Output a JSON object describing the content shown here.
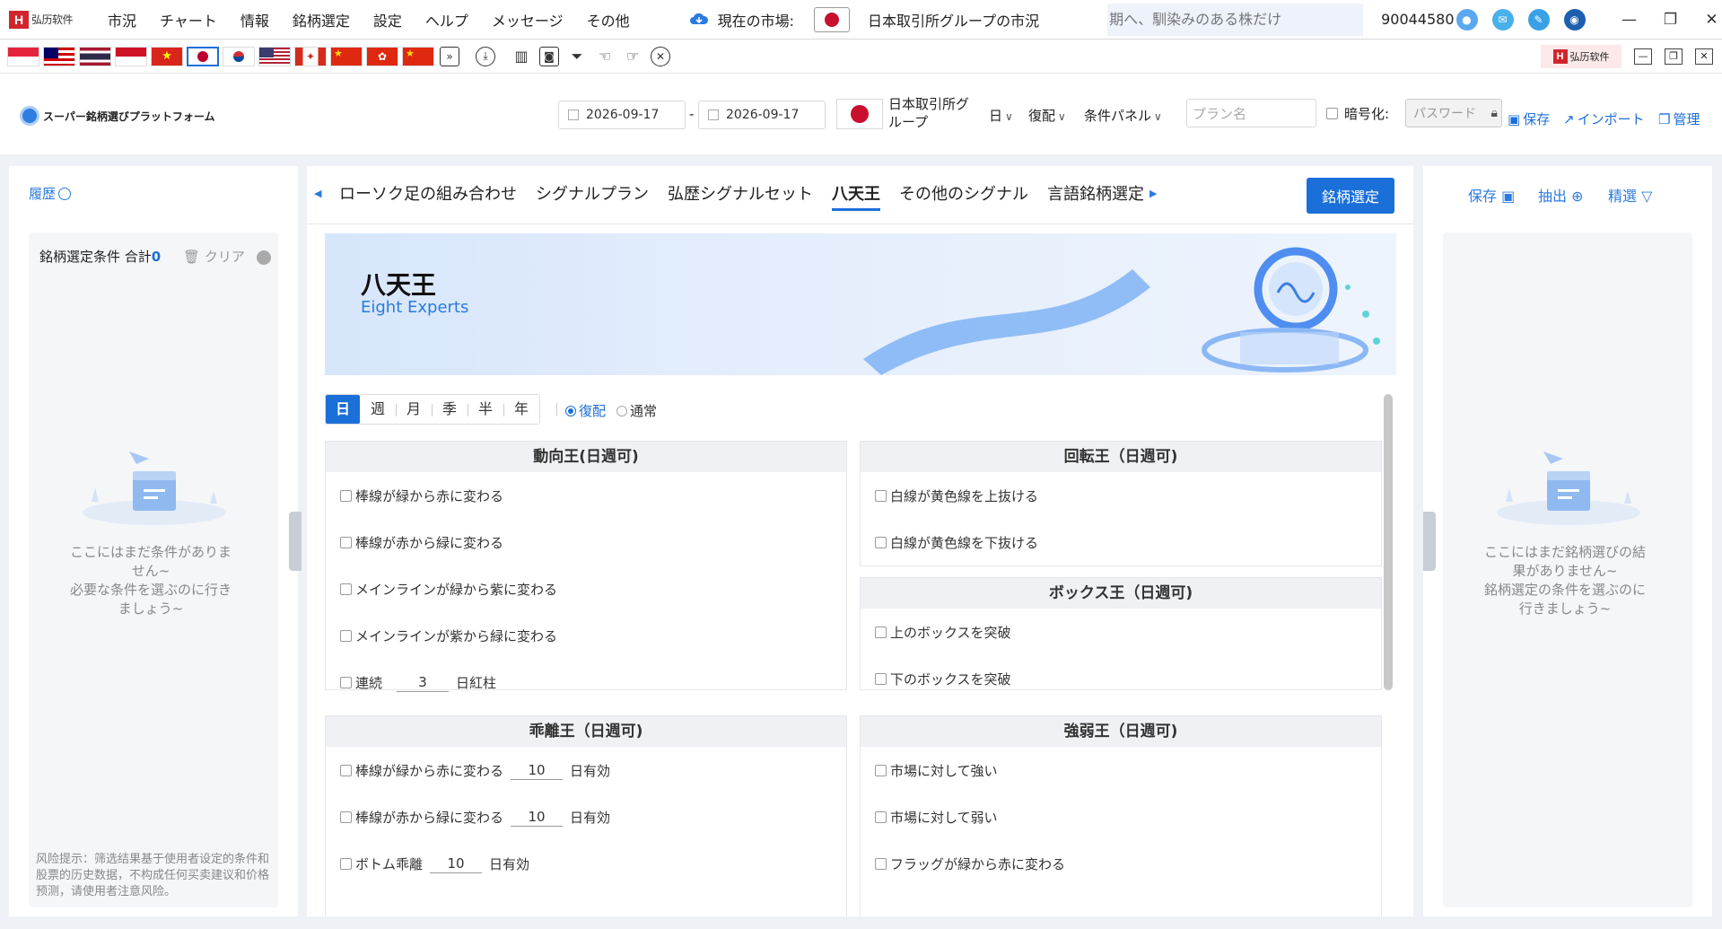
{
  "app": {
    "logo_text": "弘历软件",
    "logo_mark": "H"
  },
  "menu": [
    "市況",
    "チャート",
    "情報",
    "銘柄選定",
    "設定",
    "ヘルプ",
    "メッセージ",
    "その他"
  ],
  "market": {
    "label": "現在の市場:",
    "name": "日本取引所グループの市況"
  },
  "search": {
    "placeholder": "期へ、馴染みのある株だけ"
  },
  "user": {
    "id": "90044580"
  },
  "toolbar": {
    "brand": "スーパー銘柄選びプラットフォーム",
    "date_start": "2026-09-17",
    "date_sep": "-",
    "date_end": "2026-09-17",
    "exchange": "日本取引所グループ",
    "period": "日",
    "adjust": "復配",
    "panel": "条件パネル",
    "plan_placeholder": "プラン名",
    "encrypt_label": "暗号化:",
    "password_placeholder": "パスワード",
    "save": "保存",
    "import": "インポート",
    "manage": "管理"
  },
  "left": {
    "history": "履歴",
    "cond_title": "銘柄選定条件 合計",
    "cond_count": "0",
    "clear": "クリア",
    "empty_line1": "ここにはまだ条件がありま",
    "empty_line2": "せん~",
    "empty_line3": "必要な条件を選ぶのに行き",
    "empty_line4": "ましょう~",
    "risk": "风险提示：筛选结果基于使用者设定的条件和股票的历史数据，不构成任何买卖建议和价格预测，请使用者注意风险。"
  },
  "tabs": [
    "ローソク足の組み合わせ",
    "シグナルプラン",
    "弘歴シグナルセット",
    "八天王",
    "その他のシグナル",
    "言語銘柄選定"
  ],
  "active_tab": 3,
  "select_button": "銘柄選定",
  "banner": {
    "title": "八天王",
    "subtitle": "Eight Experts"
  },
  "periods": [
    "日",
    "週",
    "月",
    "季",
    "半",
    "年"
  ],
  "radio": {
    "on": "復配",
    "off": "通常"
  },
  "cards": {
    "c1": {
      "title": "動向王(日週可)",
      "rows": [
        "棒線が緑から赤に変わる",
        "棒線が赤から緑に変わる",
        "メインラインが緑から紫に変わる",
        "メインラインが紫から緑に変わる"
      ],
      "last_pre": "連続",
      "last_val": "3",
      "last_post": "日紅柱"
    },
    "c2": {
      "title": "回転王（日週可)",
      "rows": [
        "白線が黄色線を上抜ける",
        "白線が黄色線を下抜ける"
      ]
    },
    "c3": {
      "title": "ボックス王（日週可)",
      "rows": [
        "上のボックスを突破",
        "下のボックスを突破"
      ]
    },
    "c4": {
      "title": "乖離王（日週可)",
      "r1": "棒線が緑から赤に変わる",
      "r1v": "10",
      "r2": "棒線が赤から緑に変わる",
      "r2v": "10",
      "r3": "ボトム乖離",
      "r3v": "10",
      "suffix": "日有効"
    },
    "c5": {
      "title": "強弱王（日週可)",
      "rows": [
        "市場に対して強い",
        "市場に対して弱い",
        "フラッグが緑から赤に変わる"
      ]
    }
  },
  "right": {
    "save": "保存",
    "extract": "抽出",
    "refine": "精選",
    "empty_line1": "ここにはまだ銘柄選びの結",
    "empty_line2": "果がありません~",
    "empty_line3": "銘柄選定の条件を選ぶのに",
    "empty_line4": "行きましょう~"
  },
  "colors": {
    "accent": "#1b6fd9",
    "brand_red": "#d0262d"
  }
}
